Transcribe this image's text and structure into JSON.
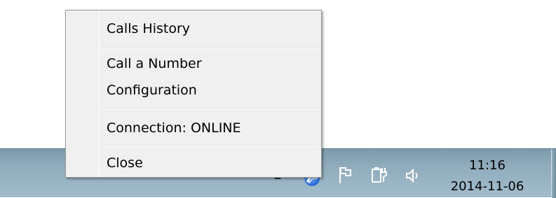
{
  "menu": {
    "items": [
      {
        "label": "Calls History"
      },
      {
        "label": "Call a Number"
      },
      {
        "label": "Configuration"
      },
      {
        "label": "Connection: ONLINE"
      },
      {
        "label": "Close"
      }
    ]
  },
  "tray": {
    "icons": [
      "show-hidden-icons-arrow",
      "app-tray-icon",
      "action-center-flag-icon",
      "power-icon",
      "volume-icon"
    ]
  },
  "clock": {
    "time": "11:16",
    "date": "2014-11-06"
  },
  "colors": {
    "taskbar": "#90acbc",
    "menu_bg": "#f0f0f0",
    "menu_border": "#979797"
  }
}
